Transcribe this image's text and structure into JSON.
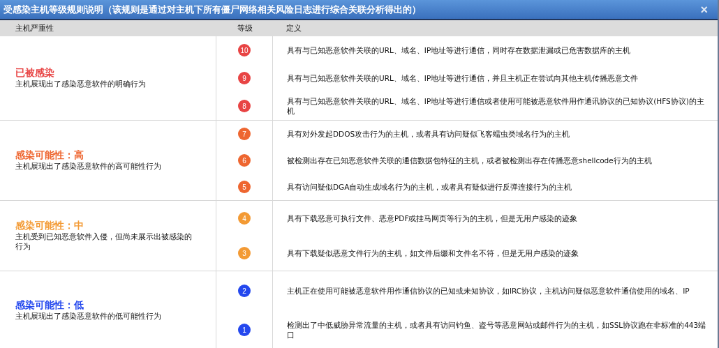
{
  "window": {
    "title": "受感染主机等级规则说明（该规则是通过对主机下所有僵尸网络相关风险日志进行综合关联分析得出的）",
    "close": "×"
  },
  "table": {
    "columns": [
      "主机严重性",
      "等级",
      "定义"
    ],
    "groups": [
      {
        "title": "已被感染",
        "description": "主机展现出了感染恶意软件的明确行为",
        "color": "#e84444",
        "levels": [
          {
            "level": "10",
            "definition": "具有与已知恶意软件关联的URL、域名、IP地址等进行通信，同时存在数据泄漏或已危害数据库的主机"
          },
          {
            "level": "9",
            "definition": "具有与已知恶意软件关联的URL、域名、IP地址等进行通信，并且主机正在尝试向其他主机传播恶意文件"
          },
          {
            "level": "8",
            "definition": "具有与已知恶意软件关联的URL、域名、IP地址等进行通信或者使用可能被恶意软件用作通讯协议的已知协议(HFS协议)的主机"
          }
        ]
      },
      {
        "title": "感染可能性：高",
        "description": "主机展现出了感染恶意软件的高可能性行为",
        "color": "#ee6630",
        "levels": [
          {
            "level": "7",
            "definition": "具有对外发起DDOS攻击行为的主机，或者具有访问疑似飞客蠕虫类域名行为的主机"
          },
          {
            "level": "6",
            "definition": "被检测出存在已知恶意软件关联的通信数据包特征的主机，或者被检测出存在传播恶意shellcode行为的主机"
          },
          {
            "level": "5",
            "definition": "具有访问疑似DGA自动生成域名行为的主机，或者具有疑似进行反弹连接行为的主机"
          }
        ]
      },
      {
        "title": "感染可能性：中",
        "description": "主机受到已知恶意软件入侵，但尚未展示出被感染的行为",
        "color": "#f39a34",
        "levels": [
          {
            "level": "4",
            "definition": "具有下载恶意可执行文件、恶意PDF或挂马网页等行为的主机，但是无用户感染的迹象"
          },
          {
            "level": "3",
            "definition": "具有下载疑似恶意文件行为的主机，如文件后缀和文件名不符，但是无用户感染的迹象"
          }
        ]
      },
      {
        "title": "感染可能性：低",
        "description": "主机展现出了感染恶意软件的低可能性行为",
        "color": "#2448ee",
        "levels": [
          {
            "level": "2",
            "definition": "主机正在使用可能被恶意软件用作通信协议的已知或未知协议，如IRC协议，主机访问疑似恶意软件通信使用的域名、IP"
          },
          {
            "level": "1",
            "definition": "检测出了中低威胁异常流量的主机，或者具有访问钓鱼、盗号等恶意网站或邮件行为的主机，如SSL协议跑在非标准的443端口"
          }
        ]
      }
    ]
  }
}
